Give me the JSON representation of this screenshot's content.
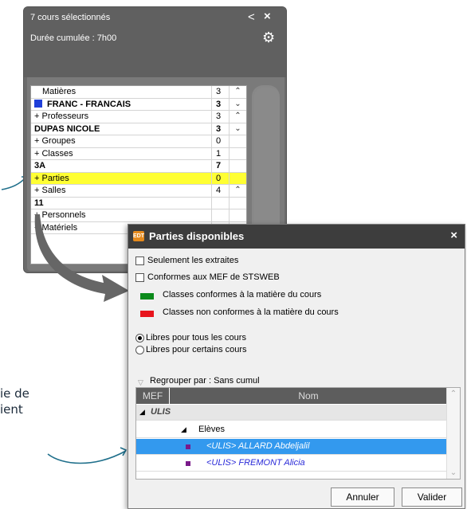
{
  "annotation": {
    "line1": "ie de",
    "line2": "ient"
  },
  "panel": {
    "title": "7 cours sélectionnés",
    "duration": "Durée cumulée : 7h00",
    "rows": [
      {
        "label": "Matières",
        "count": "3",
        "arrow": "^"
      },
      {
        "label": "FRANC - FRANCAIS",
        "count": "3",
        "arrow": "v"
      },
      {
        "label": "+ Professeurs",
        "count": "3",
        "arrow": "^"
      },
      {
        "label": "DUPAS NICOLE",
        "count": "3",
        "arrow": "v"
      },
      {
        "label": "+ Groupes",
        "count": "0",
        "arrow": ""
      },
      {
        "label": "+ Classes",
        "count": "1",
        "arrow": ""
      },
      {
        "label": "3A",
        "count": "7",
        "arrow": ""
      },
      {
        "label": "+ Parties",
        "count": "0",
        "arrow": ""
      },
      {
        "label": "+ Salles",
        "count": "4",
        "arrow": "^"
      },
      {
        "label": "11",
        "count": "",
        "arrow": ""
      },
      {
        "label": "+ Personnels",
        "count": "",
        "arrow": ""
      },
      {
        "label": "+ Matériels",
        "count": "",
        "arrow": ""
      }
    ]
  },
  "dialog": {
    "title": "Parties disponibles",
    "logo": "EDT",
    "close": "×",
    "check1": "Seulement les extraites",
    "check2": "Conformes aux MEF de STSWEB",
    "legend_green": "Classes conformes à la matière du cours",
    "legend_red": "Classes non conformes à la matière du cours",
    "radio1": "Libres pour tous les cours",
    "radio2": "Libres pour certains cours",
    "group_by": "Regrouper par : Sans cumul",
    "col_mef": "MEF",
    "col_nom": "Nom",
    "group_label": "ULIS",
    "sub_group": "Elèves",
    "items": [
      "<ULIS> ALLARD Abdeljalil",
      "<ULIS> FREMONT Alicia"
    ],
    "btn_cancel": "Annuler",
    "btn_ok": "Valider"
  },
  "colors": {
    "green": "#0a8a1a",
    "red": "#e8141c",
    "selection": "#3399ee",
    "highlight": "#ffff33"
  }
}
